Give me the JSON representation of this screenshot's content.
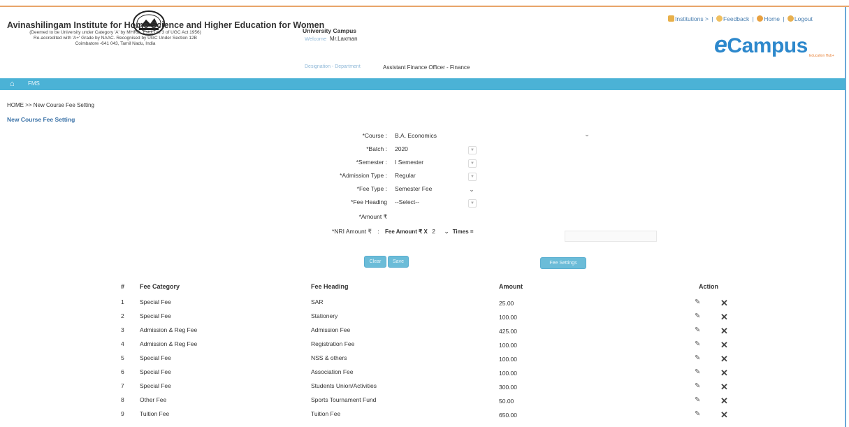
{
  "header": {
    "institution_name": "Avinashilingam Institute for Home Science and Higher Education for Women",
    "institution_lines": [
      "(Deemed to be University under Category 'A' by MHRD, Estd. u/s 3 of UGC Act 1956)",
      "Re-accredited with 'A+' Grade by NAAC. Recognised by UGC Under Section 12B",
      "Coimbatore -641 043, Tamil Nadu, India"
    ],
    "campus_title": "University Campus",
    "welcome_label": "Welcome",
    "welcome_user": "Mr.Laxman",
    "designation_label": "Designation - Department",
    "designation_value": "Assistant Finance Officer - Finance",
    "links": {
      "institutions": "Institutions >",
      "feedback": "Feedback",
      "home": "Home",
      "logout": "Logout"
    },
    "brand": "Campus",
    "brand_tag": "Education Hub+"
  },
  "nav": {
    "home_icon": "home-icon",
    "item": "FMS"
  },
  "breadcrumb": "HOME >> New Course Fee Setting",
  "page_title": "New Course Fee Setting",
  "form": {
    "course_label": "*Course :",
    "course_value": "B.A. Economics",
    "batch_label": "*Batch :",
    "batch_value": "2020",
    "semester_label": "*Semester :",
    "semester_value": "I Semester",
    "admission_label": "*Admission Type :",
    "admission_value": "Regular",
    "feetype_label": "*Fee Type :",
    "feetype_value": "Semester Fee",
    "feeheading_label": "*Fee Heading",
    "feeheading_value": "--Select--",
    "amount_label": "*Amount ₹",
    "nri_label": "*NRI Amount ₹",
    "nri_sep": ":",
    "nri_text": "Fee Amount ₹ X",
    "nri_times_value": "2",
    "nri_times_suffix": "Times ="
  },
  "buttons": {
    "clear": "Clear",
    "save": "Save",
    "fee_settings": "Fee Settings"
  },
  "table": {
    "headers": [
      "#",
      "Fee Category",
      "Fee Heading",
      "Amount",
      "Action"
    ],
    "rows": [
      {
        "no": "1",
        "category": "Special Fee",
        "heading": "SAR",
        "amount": "25.00"
      },
      {
        "no": "2",
        "category": "Special Fee",
        "heading": "Stationery",
        "amount": "100.00"
      },
      {
        "no": "3",
        "category": "Admission & Reg Fee",
        "heading": "Admission Fee",
        "amount": "425.00"
      },
      {
        "no": "4",
        "category": "Admission & Reg Fee",
        "heading": "Registration Fee",
        "amount": "100.00"
      },
      {
        "no": "5",
        "category": "Special Fee",
        "heading": "NSS & others",
        "amount": "100.00"
      },
      {
        "no": "6",
        "category": "Special Fee",
        "heading": "Association Fee",
        "amount": "100.00"
      },
      {
        "no": "7",
        "category": "Special Fee",
        "heading": "Students Union/Activities",
        "amount": "300.00"
      },
      {
        "no": "8",
        "category": "Other Fee",
        "heading": "Sports Tournament Fund",
        "amount": "50.00"
      },
      {
        "no": "9",
        "category": "Tuition Fee",
        "heading": "Tuition Fee",
        "amount": "650.00"
      }
    ],
    "edit_icon": "pencil-icon",
    "delete_icon": "close-icon"
  },
  "colors": {
    "navbar": "#4bb2d6",
    "accent_blue": "#2d88cc",
    "title_blue": "#3c73a8"
  }
}
